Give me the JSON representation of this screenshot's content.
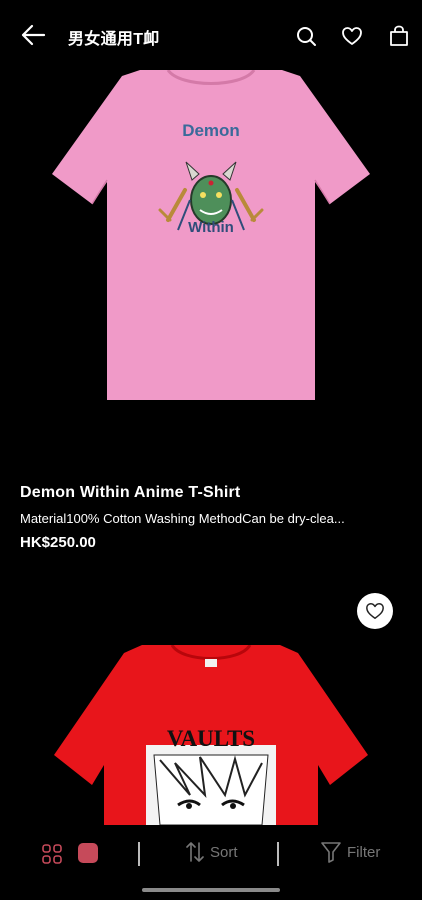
{
  "header": {
    "title": "男女通用T卹",
    "icons": [
      "back-arrow-icon",
      "search-icon",
      "heart-icon",
      "shopping-bag-icon"
    ]
  },
  "product": {
    "name": "Demon Within Anime T-Shirt",
    "description": "Material100% Cotton Washing MethodCan be dry-clea...",
    "price": "HK$250.00",
    "image": {
      "shirt_color": "#f09ac8",
      "print_top": "Demon",
      "print_bottom": "Within"
    }
  },
  "next_product": {
    "image": {
      "shirt_color": "#e8151b",
      "print_title": "VAULTS"
    }
  },
  "bottom_bar": {
    "sort_label": "Sort",
    "filter_label": "Filter",
    "active_view_color": "#c64a5a"
  }
}
